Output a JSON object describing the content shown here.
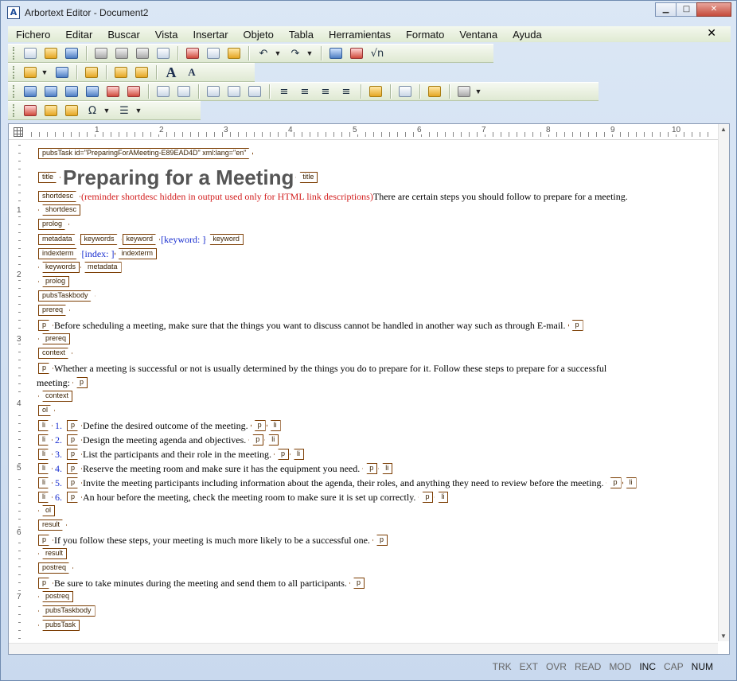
{
  "window": {
    "title": "Arbortext Editor - Document2",
    "app_icon": "A"
  },
  "menu": {
    "items": [
      "Fichero",
      "Editar",
      "Buscar",
      "Vista",
      "Insertar",
      "Objeto",
      "Tabla",
      "Herramientas",
      "Formato",
      "Ventana",
      "Ayuda"
    ],
    "close_glyph": "✕"
  },
  "toolbar": {
    "font_large": "A",
    "font_small": "A"
  },
  "ruler": {
    "numbers": [
      "1",
      "2",
      "3",
      "4",
      "5",
      "6",
      "7",
      "8",
      "9",
      "10"
    ],
    "vnumbers": [
      "1",
      "2",
      "3",
      "4",
      "5",
      "6",
      "7"
    ]
  },
  "doc": {
    "pubsTask_start": "pubsTask id=\"PreparingForAMeeting-E89EAD4D\" xml:lang=\"en\"",
    "title_tag": "title",
    "title_text": "Preparing for a Meeting",
    "shortdesc_tag": "shortdesc",
    "shortdesc_note": "(reminder shortdesc hidden in output used only for HTML link descriptions)",
    "shortdesc_text": "There are certain steps you should follow to prepare for a meeting.",
    "prolog_tag": "prolog",
    "metadata_tag": "metadata",
    "keywords_tag": "keywords",
    "keyword_tag": "keyword",
    "keyword_placeholder": "[keyword: ]",
    "indexterm_tag": "indexterm",
    "index_placeholder": "[index: ]",
    "pubsTaskbody_tag": "pubsTaskbody",
    "prereq_tag": "prereq",
    "p_tag": "p",
    "prereq_text": "Before scheduling a meeting, make sure that the things you want to discuss cannot be handled in another way such as through E-mail.",
    "context_tag": "context",
    "context_text_1": "Whether a meeting is successful or not is usually determined by the things you do to prepare for it. Follow these steps to prepare for a successful",
    "context_text_2": "meeting:",
    "ol_tag": "ol",
    "li_tag": "li",
    "steps": [
      {
        "num": "1.",
        "text": "Define the desired outcome of the meeting."
      },
      {
        "num": "2.",
        "text": "Design the meeting agenda and objectives."
      },
      {
        "num": "3.",
        "text": "List the participants and their role in the meeting."
      },
      {
        "num": "4.",
        "text": "Reserve the meeting room and make sure it has the equipment you need."
      },
      {
        "num": "5.",
        "text": "Invite the meeting participants including information about the agenda, their roles, and anything they need to review before the meeting."
      },
      {
        "num": "6.",
        "text": "An hour before the meeting, check the meeting room to make sure it is set up correctly."
      }
    ],
    "result_tag": "result",
    "result_text": "If you follow these steps, your meeting is much more likely to be a successful one.",
    "postreq_tag": "postreq",
    "postreq_text": "Be sure to take minutes during the meeting and send them to all participants.",
    "pubsTask_tag": "pubsTask"
  },
  "status": {
    "items": [
      "TRK",
      "EXT",
      "OVR",
      "READ",
      "MOD",
      "INC",
      "CAP",
      "NUM"
    ],
    "active": [
      "INC",
      "NUM"
    ]
  }
}
